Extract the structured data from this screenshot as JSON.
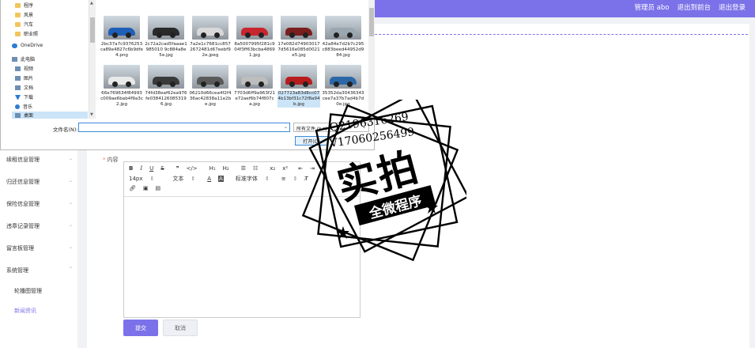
{
  "header": {
    "admin_label": "管理员 abo",
    "back_label": "退出到前台",
    "logout_label": "退出登录"
  },
  "sidebar": {
    "items": [
      {
        "label": "续租信息管理"
      },
      {
        "label": "归还信息管理"
      },
      {
        "label": "保险信息管理"
      },
      {
        "label": "违章记录管理"
      },
      {
        "label": "留言板管理"
      },
      {
        "label": "系统管理"
      }
    ],
    "sub_items": [
      {
        "label": "轮播图管理"
      },
      {
        "label": "新闻资讯"
      }
    ]
  },
  "form": {
    "content_label": "内容",
    "required_mark": "*",
    "submit_label": "提交",
    "cancel_label": "取消"
  },
  "editor": {
    "font_size": "14px",
    "paragraph": "文本",
    "font_family": "标准字体"
  },
  "dialog": {
    "nav": [
      {
        "label": "程序",
        "icon": "folder-icon"
      },
      {
        "label": "风景",
        "icon": "folder-icon"
      },
      {
        "label": "汽车",
        "icon": "folder-icon"
      },
      {
        "label": "职业照",
        "icon": "folder-icon"
      },
      {
        "label": "OneDrive",
        "icon": "cloud-icon"
      },
      {
        "label": "此电脑",
        "icon": "computer-icon"
      },
      {
        "label": "视频",
        "icon": "video-icon"
      },
      {
        "label": "图片",
        "icon": "picture-icon"
      },
      {
        "label": "文档",
        "icon": "document-icon"
      },
      {
        "label": "下载",
        "icon": "download-icon"
      },
      {
        "label": "音乐",
        "icon": "music-icon"
      },
      {
        "label": "桌面",
        "icon": "desktop-icon"
      }
    ],
    "files": [
      {
        "name": "2bc37a7c9376253ca89e4827c6b9dfe4.png",
        "color": "#1f5fb8"
      },
      {
        "name": "2c72a2cad5faaae1985010 9c884a8e5e.jpg",
        "color": "#2a2a2a"
      },
      {
        "name": "7a2e1c7681cc8572672481d67eebf92e.jpeg",
        "color": "#d8d8d8"
      },
      {
        "name": "8a5007995f281c904f3ff63bcba48691.jpg",
        "color": "#c8262e"
      },
      {
        "name": "17e082d749030177d5616e085d0021e5.jpg",
        "color": "#7a1e1e"
      },
      {
        "name": "42a84e7d2b7c295c883beed44952d984.jpg",
        "color": "#9aa7b0"
      },
      {
        "name": "66e769634f84993c009ae6bab4f9a3c2.jpg",
        "color": "#e9e9e9"
      },
      {
        "name": "74fd38eaf62ea976fe03841260853196.jpg",
        "color": "#3a3a3a"
      },
      {
        "name": "06210d66cea4f2f436ac42838a11e2be.jpg",
        "color": "#5a5a5a"
      },
      {
        "name": "7703d6ff9a963f21e72aef6b74f807ca.jpg",
        "color": "#bdbdbd"
      },
      {
        "name": "027723a83d8cc074b13bf31c72f8a94b.jpg",
        "color": "#b71d1d"
      },
      {
        "name": "35352da30436343cee7a37b7ad4b7d0e.jpg",
        "color": "#2c68a8"
      }
    ],
    "filename_label": "文件名(N):",
    "filename_value": "",
    "filetype_label": "所有文件 (*.*)",
    "open_label": "打开(O)"
  },
  "stamp": {
    "line1": "Q2196316269",
    "line2": "V17060256499",
    "main": "实拍",
    "banner": "全微程序"
  }
}
